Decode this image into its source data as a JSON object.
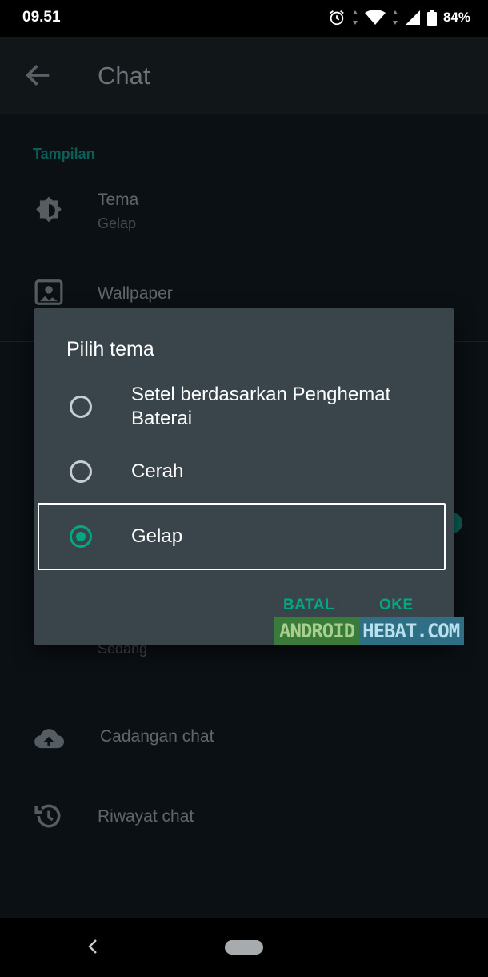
{
  "status_bar": {
    "time": "09.51",
    "battery": "84%",
    "icons": [
      "alarm-icon",
      "wifi-icon",
      "signal-icon",
      "battery-icon"
    ]
  },
  "app_bar": {
    "title": "Chat",
    "back_icon": "arrow-left-icon"
  },
  "settings": {
    "section_label": "Tampilan",
    "theme": {
      "title": "Tema",
      "subtitle": "Gelap",
      "icon": "brightness-icon"
    },
    "wallpaper": {
      "title": "Wallpaper",
      "icon": "wallpaper-icon"
    },
    "font_size_value": "Sedang",
    "backup": {
      "title": "Cadangan chat",
      "icon": "cloud-upload-icon"
    },
    "history": {
      "title": "Riwayat chat",
      "icon": "history-icon"
    }
  },
  "dialog": {
    "title": "Pilih tema",
    "options": [
      {
        "label": "Setel berdasarkan Penghemat Baterai",
        "selected": false
      },
      {
        "label": "Cerah",
        "selected": false
      },
      {
        "label": "Gelap",
        "selected": true
      }
    ],
    "cancel_label": "BATAL",
    "ok_label": "OKE"
  },
  "watermark": {
    "part1": "ANDROID",
    "part2": "HEBAT.COM"
  },
  "colors": {
    "accent": "#00a884",
    "dialog_bg": "#3a454b",
    "background": "#0b1014"
  }
}
